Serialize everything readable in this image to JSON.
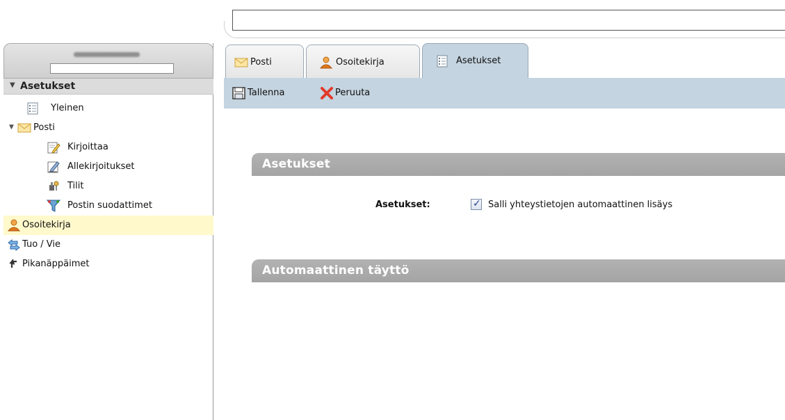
{
  "search": {
    "value": "",
    "placeholder": ""
  },
  "sidebar": {
    "header": "Asetukset",
    "items": [
      {
        "label": "Yleinen",
        "icon": "settings-list-icon"
      },
      {
        "label": "Posti",
        "icon": "mail-envelope-icon",
        "expanded": true
      },
      {
        "label": "Kirjoittaa",
        "icon": "compose-icon"
      },
      {
        "label": "Allekirjoitukset",
        "icon": "signature-icon"
      },
      {
        "label": "Tilit",
        "icon": "accounts-icon"
      },
      {
        "label": "Postin suodattimet",
        "icon": "filter-icon"
      },
      {
        "label": "Osoitekirja",
        "icon": "contact-icon",
        "selected": true
      },
      {
        "label": "Tuo / Vie",
        "icon": "import-export-icon"
      },
      {
        "label": "Pikanäppäimet",
        "icon": "shortcut-icon"
      }
    ],
    "selected_color": "#fff9cc"
  },
  "tabs": [
    {
      "label": "Posti",
      "icon": "mail-envelope-icon"
    },
    {
      "label": "Osoitekirja",
      "icon": "contact-icon"
    },
    {
      "label": "Asetukset",
      "icon": "settings-list-icon",
      "active": true
    }
  ],
  "toolbar": {
    "save_label": "Tallenna",
    "cancel_label": "Peruuta"
  },
  "main": {
    "section1_title": "Asetukset",
    "form_label": "Asetukset:",
    "checkbox_label": "Salli yhteystietojen automaattinen lisäys",
    "checkbox_checked": true,
    "section2_title": "Automaattinen täyttö"
  },
  "colors": {
    "accent": "#c4d4e0",
    "section_bar": "#aaaaaa"
  }
}
